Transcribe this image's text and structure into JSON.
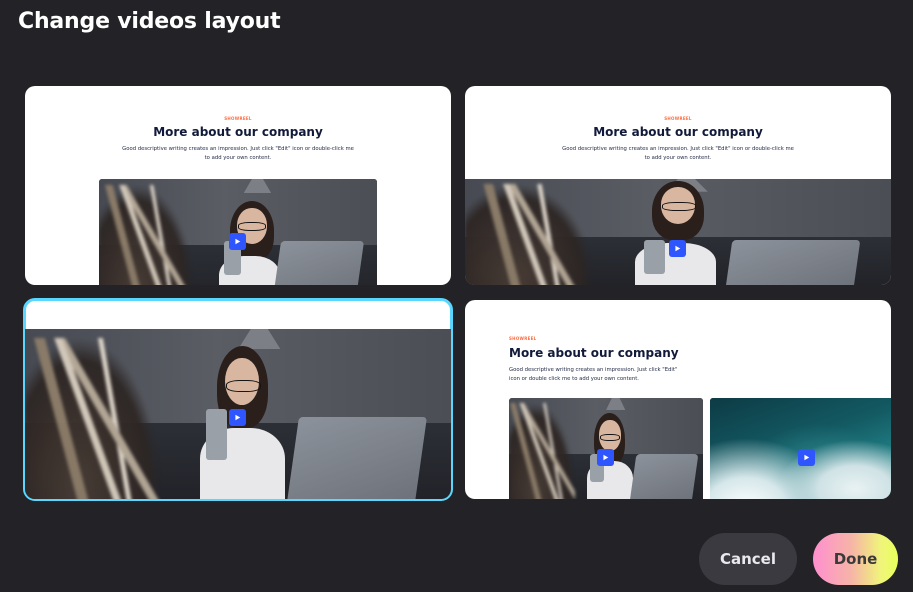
{
  "dialog": {
    "title": "Change videos layout",
    "cancel_label": "Cancel",
    "done_label": "Done"
  },
  "layouts": [
    {
      "eyebrow": "SHOWREEL",
      "heading": "More about our company",
      "description_line1": "Good descriptive writing creates an impression. Just click \"Edit\" icon or double-click me",
      "description_line2": "to add your own content.",
      "selected": false
    },
    {
      "eyebrow": "SHOWREEL",
      "heading": "More about our company",
      "description_line1": "Good descriptive writing creates an impression. Just click \"Edit\" icon or double-click me",
      "description_line2": "to add your own content.",
      "selected": false
    },
    {
      "selected": true
    },
    {
      "eyebrow": "SHOWREEL",
      "heading": "More about our company",
      "description_line1": "Good descriptive writing creates an impression. Just click \"Edit\"",
      "description_line2": "icon or double click me to add your own content.",
      "selected": false
    }
  ],
  "colors": {
    "background": "#232226",
    "selected_outline": "#5ad7ff",
    "play_button": "#2f55ff",
    "eyebrow": "#ff6a3d",
    "heading": "#111a3a"
  },
  "icons": {
    "play": "play-icon"
  }
}
